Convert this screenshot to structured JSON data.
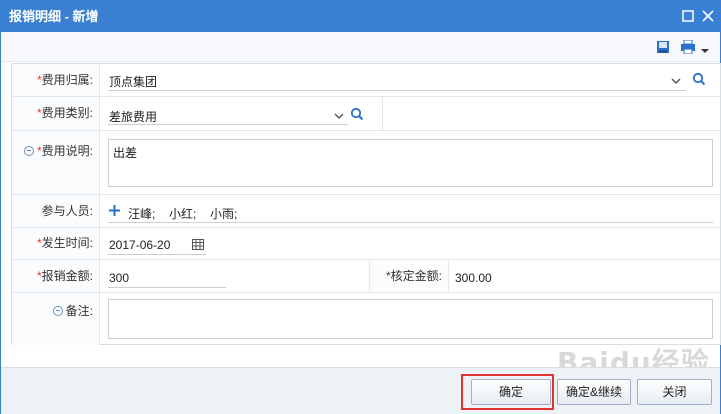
{
  "window": {
    "title": "报销明细 - 新增"
  },
  "form": {
    "expense_owner": {
      "label": "费用归属:",
      "value": "顶点集团"
    },
    "expense_category": {
      "label": "费用类别:",
      "value": "差旅费用"
    },
    "expense_description": {
      "label": "费用说明:",
      "value": "出差"
    },
    "participants": {
      "label": "参与人员:",
      "values": [
        "汪峰;",
        "小红;",
        "小雨;"
      ]
    },
    "occurrence_date": {
      "label": "发生时间:",
      "value": "2017-06-20"
    },
    "reimburse_amount": {
      "label": "报销金额:",
      "value": "300"
    },
    "approved_amount": {
      "label": "核定金额:",
      "value": "300.00"
    },
    "remarks": {
      "label": "备注:",
      "value": ""
    },
    "required_mark": "*"
  },
  "buttons": {
    "confirm": "确定",
    "confirm_continue": "确定&继续",
    "close": "关闭"
  },
  "watermark": "Baidu经验",
  "colors": {
    "titlebar": "#3a80d2",
    "required": "#e33333",
    "highlight": "#e53030",
    "icon_blue": "#2a6fc9"
  }
}
